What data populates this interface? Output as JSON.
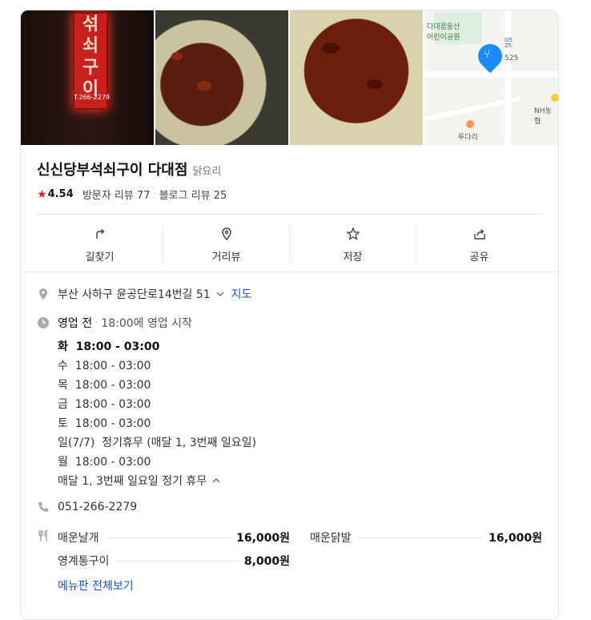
{
  "photos": {
    "sign_chars": [
      "섞",
      "쇠",
      "구",
      "이"
    ],
    "sign_tel": "T.266-2279",
    "map_labels": {
      "park": "다대꿈동산\n어린이공원",
      "gs": "GS\n25",
      "gs_num": "525",
      "nh": "NH농협",
      "poi": "투다리"
    }
  },
  "title": "신신당부석쇠구이 다대점",
  "category": "닭요리",
  "rating": {
    "score": "4.54",
    "visitor_reviews": "방문자 리뷰 77",
    "blog_reviews": "블로그 리뷰 25"
  },
  "actions": [
    {
      "label": "길찾기",
      "icon": "directions-icon"
    },
    {
      "label": "거리뷰",
      "icon": "street-view-icon"
    },
    {
      "label": "저장",
      "icon": "star-icon"
    },
    {
      "label": "공유",
      "icon": "share-icon"
    }
  ],
  "address": {
    "text": "부산 사하구 윤공단로14번길 51",
    "map_link": "지도"
  },
  "business": {
    "status": "영업 전",
    "status_detail": "18:00에 영업 시작",
    "hours": [
      {
        "day": "화",
        "time": "18:00 - 03:00"
      },
      {
        "day": "수",
        "time": "18:00 - 03:00"
      },
      {
        "day": "목",
        "time": "18:00 - 03:00"
      },
      {
        "day": "금",
        "time": "18:00 - 03:00"
      },
      {
        "day": "토",
        "time": "18:00 - 03:00"
      },
      {
        "day": "일(7/7)",
        "time": "정기휴무 (매달 1, 3번째 일요일)"
      },
      {
        "day": "월",
        "time": "18:00 - 03:00"
      }
    ],
    "note": "매달 1, 3번째 일요일 정기 휴무"
  },
  "phone": "051-266-2279",
  "menu": {
    "items": [
      {
        "name": "매운날개",
        "price": "16,000원"
      },
      {
        "name": "매운닭발",
        "price": "16,000원"
      },
      {
        "name": "영계통구이",
        "price": "8,000원"
      }
    ],
    "view_all": "메뉴판 전체보기"
  }
}
